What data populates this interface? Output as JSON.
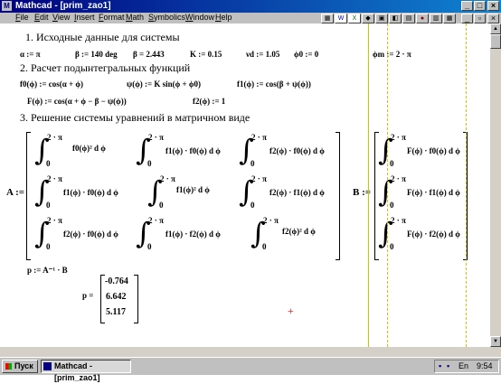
{
  "window": {
    "title": "Mathcad - [prim_zao1]",
    "app_icon": "M"
  },
  "menu": [
    "File",
    "Edit",
    "View",
    "Insert",
    "Format",
    "Math",
    "Symbolics",
    "Window",
    "Help"
  ],
  "taskbar": {
    "start": "Пуск",
    "task": "Mathcad - [prim_zao1]",
    "lang": "En",
    "time": "9:54"
  },
  "sections": {
    "s1": "1. Исходные данные для системы",
    "s2": "2. Расчет подынтегральных функций",
    "s3": "3. Решение системы уравнений в матричном виде"
  },
  "params": {
    "alpha": "α := π",
    "beta1": "β := 140 deg",
    "beta2": "β = 2.443",
    "K": "K := 0.15",
    "nu": "νd := 1.05",
    "phi0": "ϕ0 := 0",
    "phim": "ϕm := 2 · π"
  },
  "functions": {
    "f0": "f0(ϕ) := cos(α + ϕ)",
    "psi": "ψ(ϕ) := K sin(ϕ + ϕ0)",
    "f1": "f1(ϕ) := cos(β + ψ(ϕ))",
    "F": "F(ϕ) := cos(α + ϕ − β − ψ(ϕ))",
    "f2": "f2(ϕ) := 1"
  },
  "matrixA": {
    "label": "A :=",
    "limit_upper": "2 · π",
    "limit_lower": "0",
    "cells": [
      [
        "f0(ϕ)² d ϕ",
        "f1(ϕ) · f0(ϕ) d ϕ",
        "f2(ϕ) · f0(ϕ) d ϕ"
      ],
      [
        "f1(ϕ) · f0(ϕ) d ϕ",
        "f1(ϕ)² d ϕ",
        "f2(ϕ) · f1(ϕ) d ϕ"
      ],
      [
        "f2(ϕ) · f0(ϕ) d ϕ",
        "f1(ϕ) · f2(ϕ) d ϕ",
        "f2(ϕ)² d ϕ"
      ]
    ]
  },
  "matrixB": {
    "label": "B :=",
    "cells": [
      "F(ϕ) · f0(ϕ) d ϕ",
      "F(ϕ) · f1(ϕ) d ϕ",
      "F(ϕ) · f2(ϕ) d ϕ"
    ]
  },
  "solution": {
    "expr": "p := A⁻¹ · B",
    "label": "p =",
    "values": [
      "-0.764",
      "6.642",
      "5.117"
    ]
  }
}
